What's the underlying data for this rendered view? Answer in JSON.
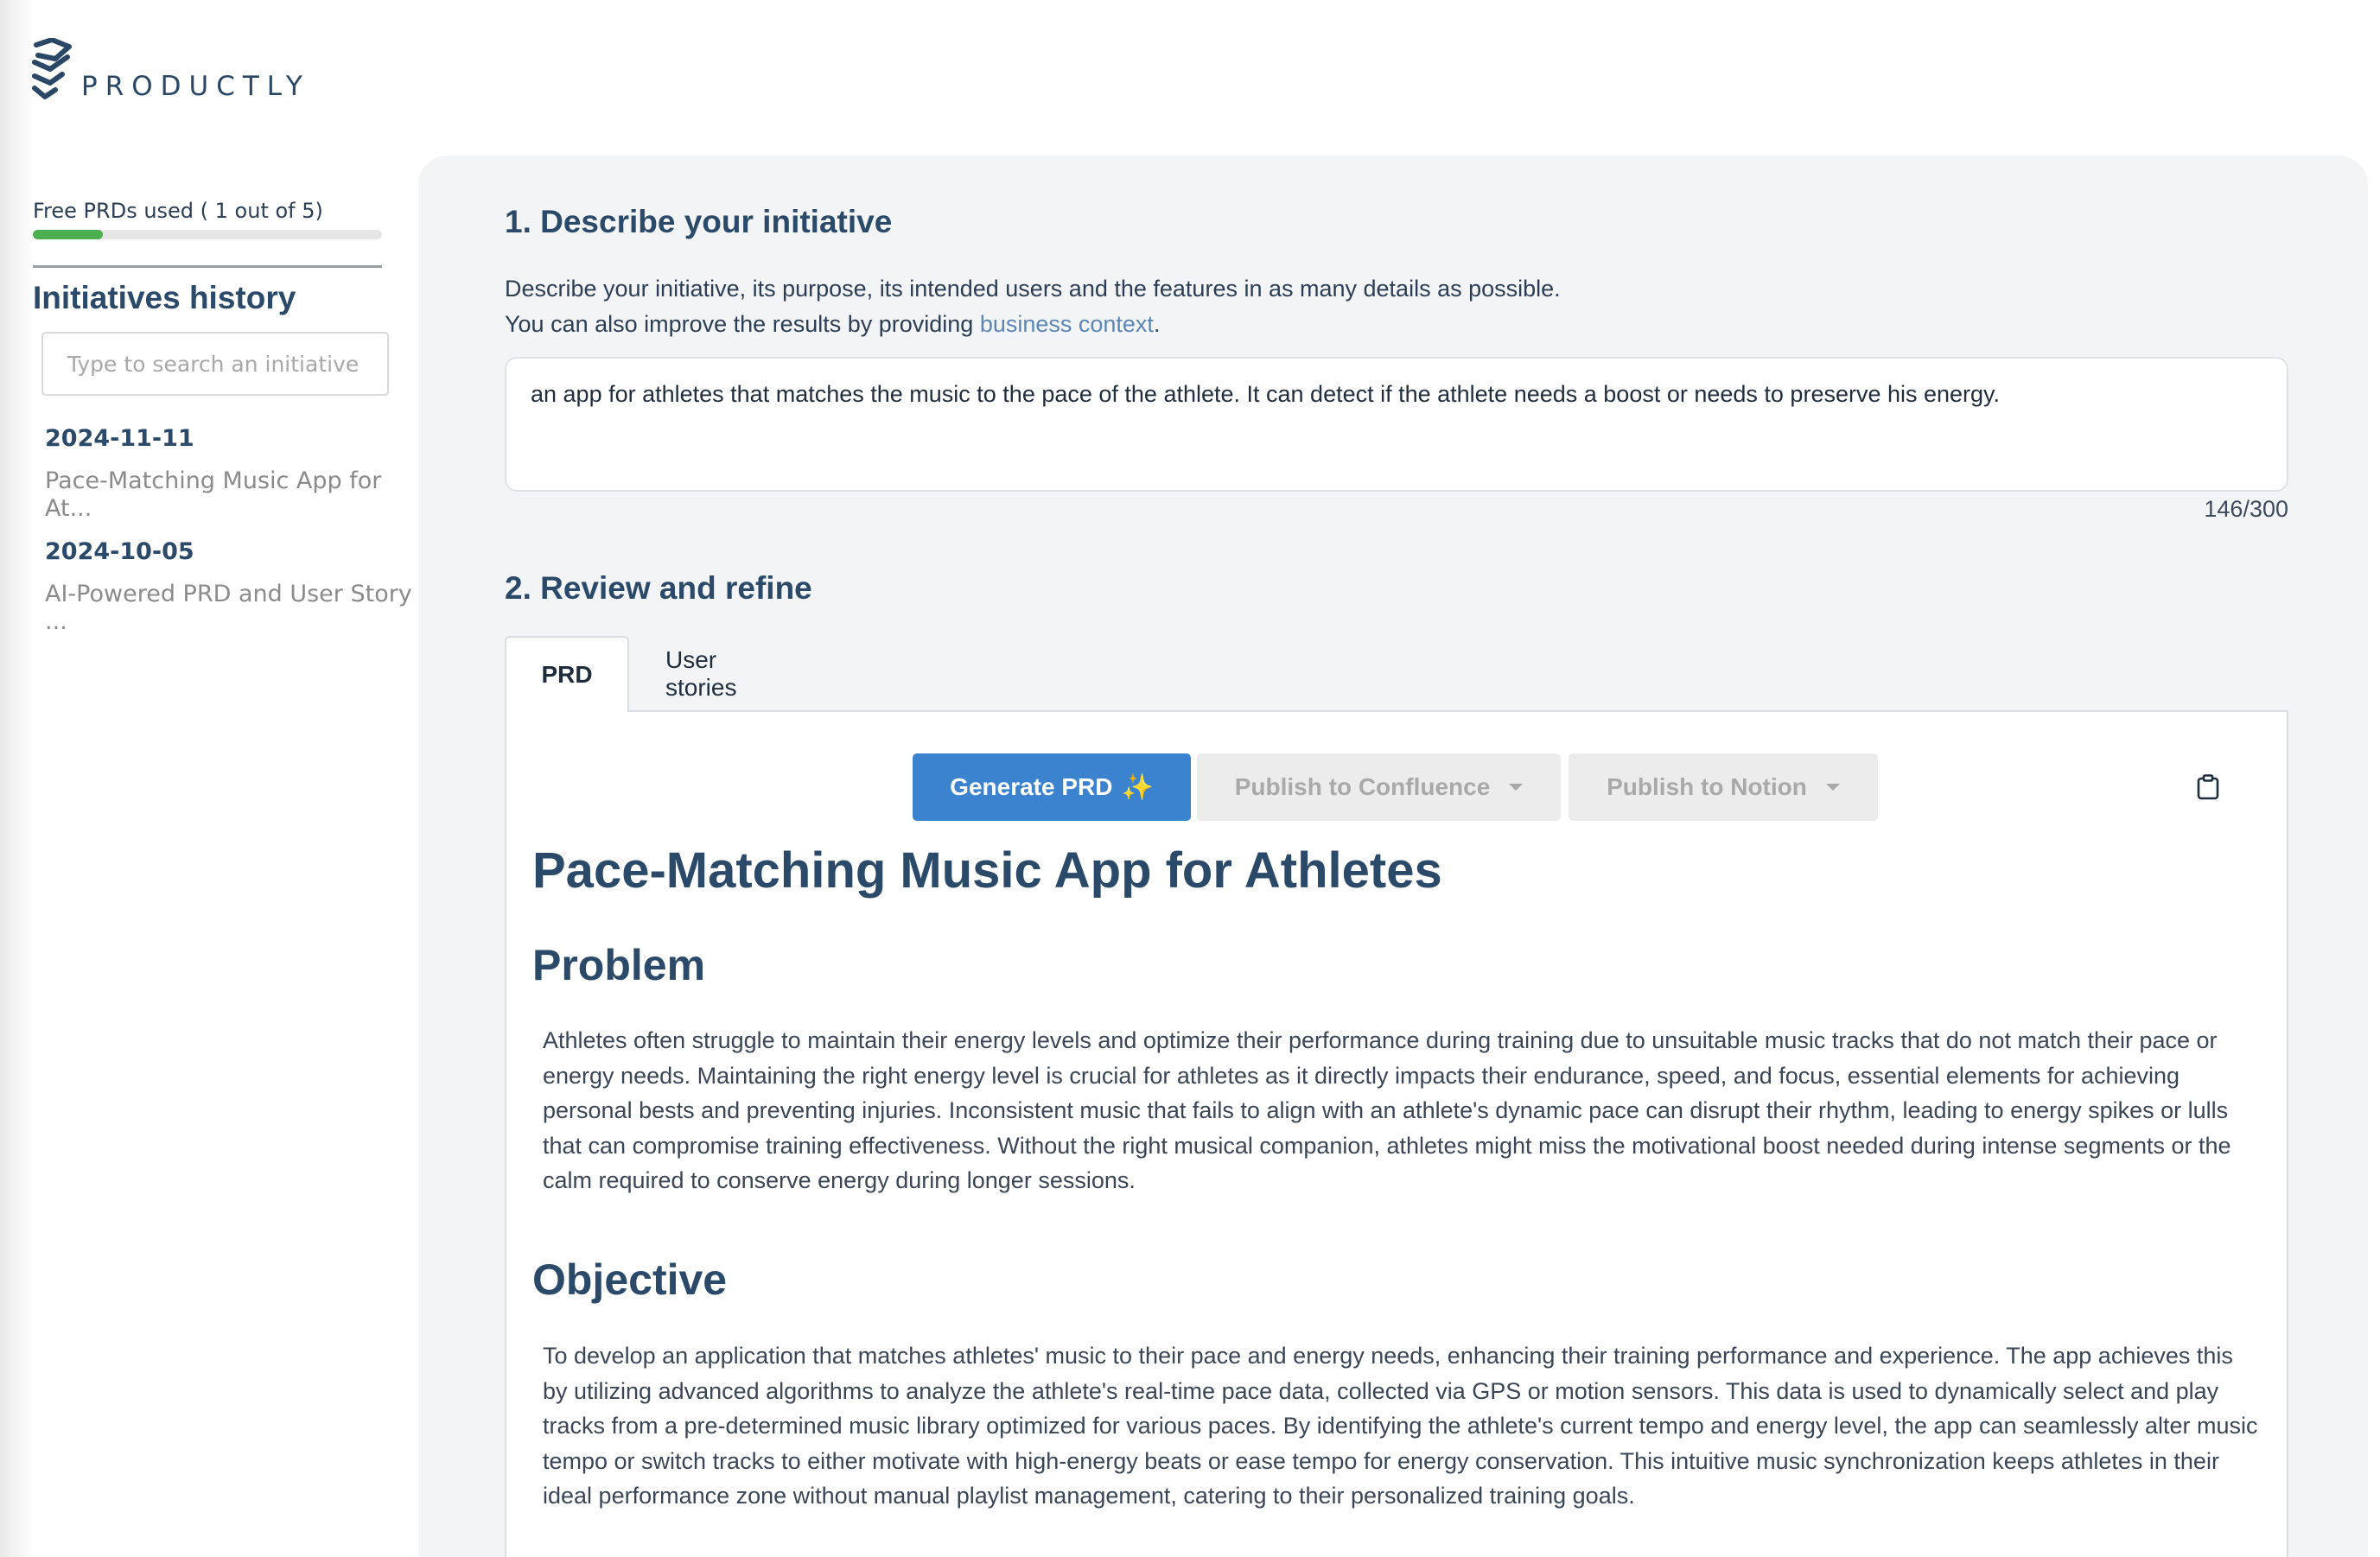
{
  "brand": {
    "name": "PRODUCTLY"
  },
  "sidebar": {
    "usage_label": "Free PRDs used ( 1 out of 5)",
    "usage_fraction": 0.2,
    "history_title": "Initiatives history",
    "search_placeholder": "Type to search an initiative",
    "history": [
      {
        "date": "2024-11-11",
        "title": "Pace-Matching Music App for At..."
      },
      {
        "date": "2024-10-05",
        "title": "AI-Powered PRD and User Story ..."
      }
    ]
  },
  "main": {
    "step1_title": "1. Describe your initiative",
    "step1_desc_line1": "Describe your initiative, its purpose, its intended users and the features in as many details as possible.",
    "step1_desc_line2_prefix": "You can also improve the results by providing ",
    "step1_desc_link": "business context",
    "step1_desc_line2_suffix": ".",
    "initiative_text": "an app for athletes that matches the music to the pace of the athlete. It can detect if the athlete needs a boost or needs to preserve his energy.",
    "char_count": "146/300",
    "step2_title": "2. Review and refine",
    "tabs": [
      "PRD",
      "User stories"
    ],
    "buttons": {
      "generate": "Generate PRD",
      "generate_icon": "sparkles-icon",
      "confluence": "Publish to Confluence",
      "notion": "Publish to Notion",
      "copy_icon": "clipboard-icon"
    }
  },
  "document": {
    "title": "Pace-Matching Music App for Athletes",
    "sections": [
      {
        "heading": "Problem",
        "body": "Athletes often struggle to maintain their energy levels and optimize their performance during training due to unsuitable music tracks that do not match their pace or energy needs. Maintaining the right energy level is crucial for athletes as it directly impacts their endurance, speed, and focus, essential elements for achieving personal bests and preventing injuries. Inconsistent music that fails to align with an athlete's dynamic pace can disrupt their rhythm, leading to energy spikes or lulls that can compromise training effectiveness. Without the right musical companion, athletes might miss the motivational boost needed during intense segments or the calm required to conserve energy during longer sessions."
      },
      {
        "heading": "Objective",
        "body": "To develop an application that matches athletes' music to their pace and energy needs, enhancing their training performance and experience. The app achieves this by utilizing advanced algorithms to analyze the athlete's real-time pace data, collected via GPS or motion sensors. This data is used to dynamically select and play tracks from a pre-determined music library optimized for various paces. By identifying the athlete's current tempo and energy level, the app can seamlessly alter music tempo or switch tracks to either motivate with high-energy beats or ease tempo for energy conservation. This intuitive music synchronization keeps athletes in their ideal performance zone without manual playlist management, catering to their personalized training goals."
      }
    ]
  },
  "colors": {
    "brand_dark": "#2b4a6a",
    "primary_button": "#3b82cf",
    "progress_fill": "#4caf50",
    "link": "#5b87b8"
  }
}
